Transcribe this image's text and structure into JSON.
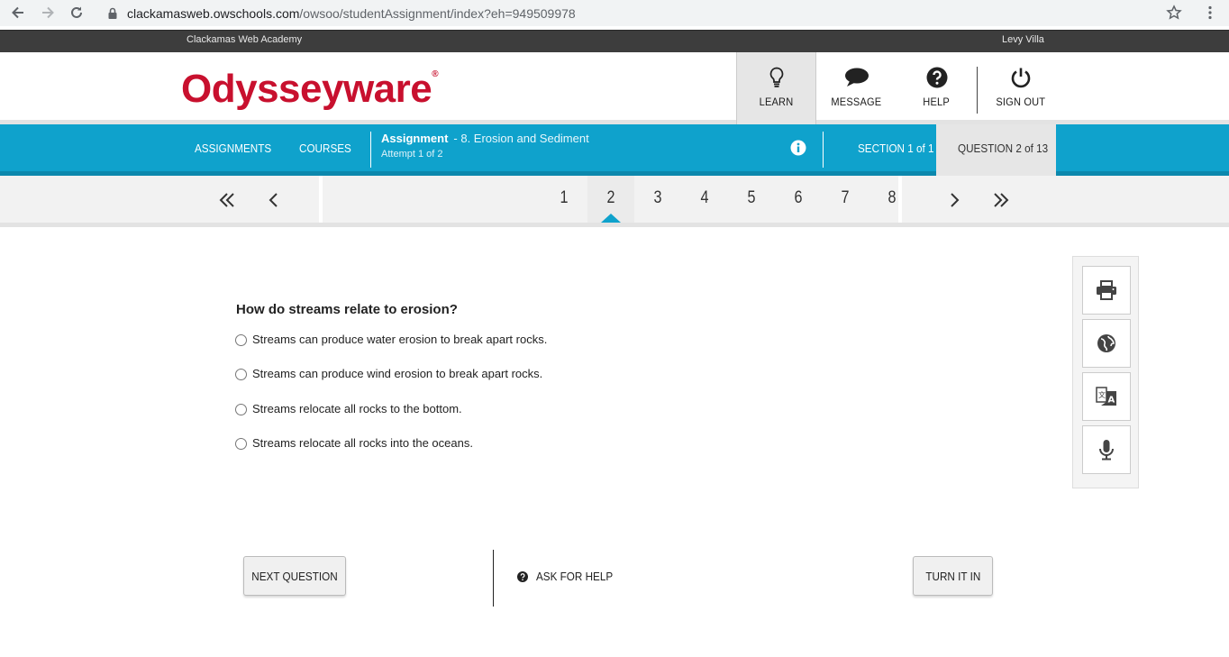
{
  "browser": {
    "url_host": "clackamasweb.owschools.com",
    "url_path": "/owsoo/studentAssignment/index?eh=949509978"
  },
  "topbar": {
    "school": "Clackamas Web Academy",
    "user": "Levy Villa"
  },
  "header": {
    "logo": "Odysseyware",
    "logo_mark": "®",
    "nav": {
      "learn": "LEARN",
      "message": "MESSAGE",
      "help": "HELP",
      "signout": "SIGN OUT"
    }
  },
  "bluebar": {
    "assignments": "ASSIGNMENTS",
    "courses": "COURSES",
    "assignment_label": "Assignment",
    "assignment_name": "- 8. Erosion and Sediment",
    "attempt": "Attempt 1 of 2",
    "section": "SECTION 1 of 1",
    "question": "QUESTION 2 of 13"
  },
  "pager": {
    "numbers": [
      "1",
      "2",
      "3",
      "4",
      "5",
      "6",
      "7",
      "8"
    ],
    "current": "2"
  },
  "question": {
    "title": "How do streams relate to erosion?",
    "options": [
      "Streams can produce water erosion to break apart rocks.",
      "Streams can produce wind erosion to break apart rocks.",
      "Streams relocate all rocks to the bottom.",
      "Streams relocate all rocks into the oceans."
    ]
  },
  "tools": [
    "print-icon",
    "globe-icon",
    "translate-icon",
    "microphone-icon"
  ],
  "footer": {
    "next_question": "NEXT QUESTION",
    "ask_for_help": "ASK FOR HELP",
    "turn_it_in": "TURN IT IN"
  },
  "colors": {
    "brand_red": "#c8102e",
    "bar_blue": "#0fa2cc"
  }
}
